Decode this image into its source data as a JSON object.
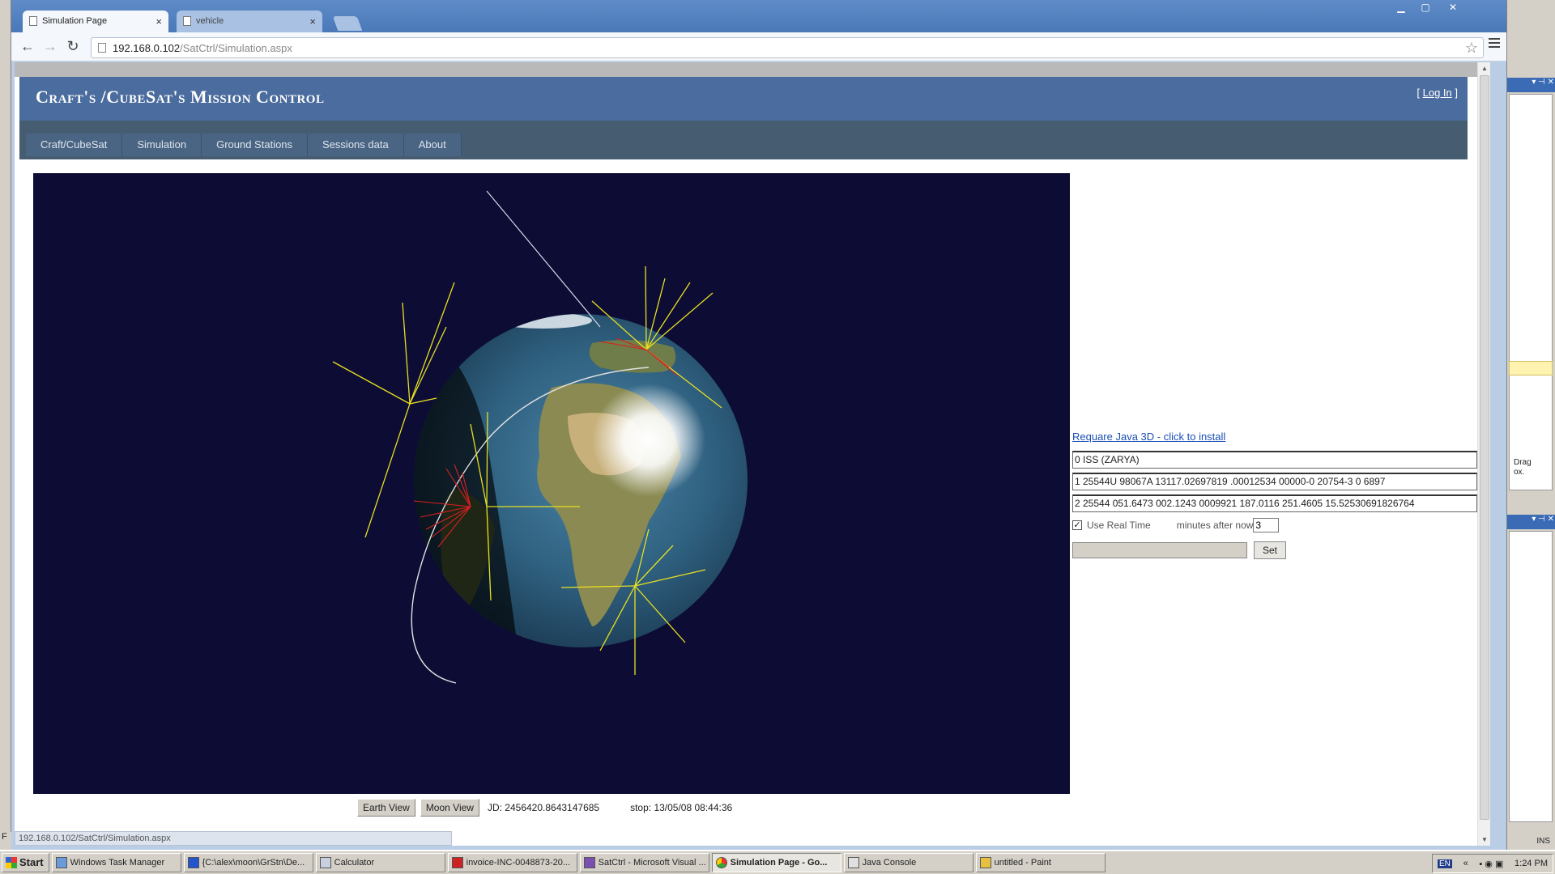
{
  "browser": {
    "tabs": [
      {
        "title": "Simulation Page",
        "active": true
      },
      {
        "title": "vehicle",
        "active": false
      }
    ],
    "url_host": "192.168.0.102",
    "url_path": "/SatCtrl/Simulation.aspx",
    "status_url": "192.168.0.102/SatCtrl/Simulation.aspx"
  },
  "site": {
    "title": "Craft's /CubeSat's Mission Control",
    "login_prefix": "[ ",
    "login_label": "Log In",
    "login_suffix": " ]",
    "menu": [
      "Craft/CubeSat",
      "Simulation",
      "Ground Stations",
      "Sessions data",
      "About"
    ]
  },
  "simulation": {
    "earth_view_label": "Earth View",
    "moon_view_label": "Moon View",
    "jd_text": "JD: 2456420.8643147685",
    "stop_text": "stop: 13/05/08 08:44:36"
  },
  "panel": {
    "java_link": "Requare Java 3D - click to install",
    "tle_name": "0 ISS (ZARYA)",
    "tle_line1": "1 25544U 98067A   13117.02697819  .00012534  00000-0  20754-3 0  6897",
    "tle_line2": "2 25544 051.6473 002.1243 0009921 187.0116 251.4605 15.52530691826764",
    "use_real_time_label": "Use Real Time",
    "use_real_time_checked": true,
    "minutes_label": "minutes after now",
    "minutes_value": "3",
    "set_label": "Set"
  },
  "ide": {
    "drag_text_1": "Drag",
    "drag_text_2": "ox.",
    "status": "INS"
  },
  "taskbar": {
    "start_label": "Start",
    "items": [
      {
        "label": "Windows Task Manager",
        "active": false
      },
      {
        "label": "{C:\\alex\\moon\\GrStn\\De...",
        "active": false
      },
      {
        "label": "Calculator",
        "active": false
      },
      {
        "label": "invoice-INC-0048873-20...",
        "active": false
      },
      {
        "label": "SatCtrl - Microsoft Visual ...",
        "active": false
      },
      {
        "label": "Simulation Page - Go...",
        "active": true
      },
      {
        "label": "Java Console",
        "active": false
      },
      {
        "label": "untitled - Paint",
        "active": false
      }
    ],
    "lang": "EN",
    "clock": "1:24 PM"
  },
  "colors": {
    "header_blue": "#4b6c9e",
    "nav_slate": "#465c71",
    "canvas_navy": "#0c0c35",
    "sensor_yellow": "#e8e020",
    "coverage_red": "#d82020",
    "link_blue": "#1a4fb5"
  }
}
